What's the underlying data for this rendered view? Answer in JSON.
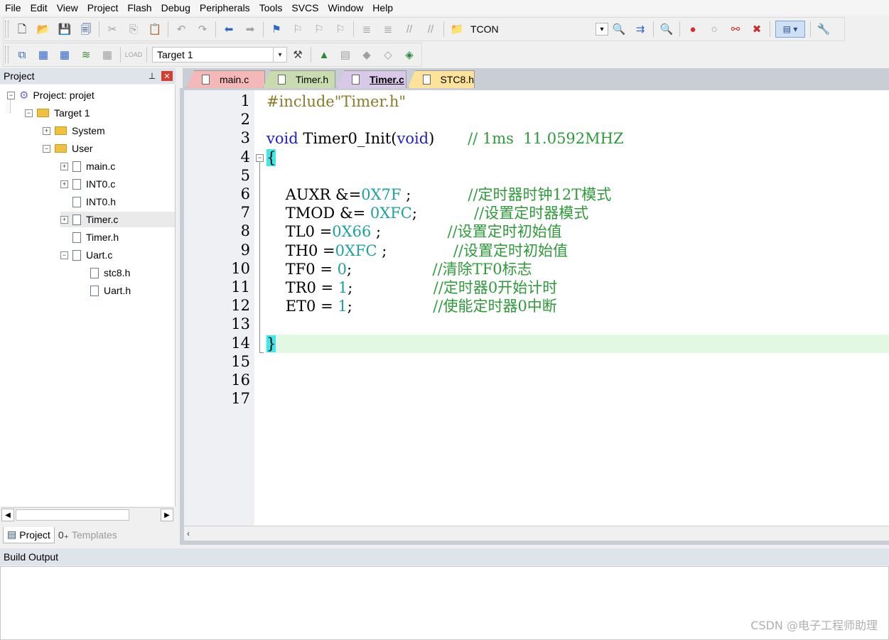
{
  "menu": [
    "File",
    "Edit",
    "View",
    "Project",
    "Flash",
    "Debug",
    "Peripherals",
    "Tools",
    "SVCS",
    "Window",
    "Help"
  ],
  "toolbar1": {
    "search_value": "TCON"
  },
  "toolbar2": {
    "target_value": "Target 1"
  },
  "project_panel": {
    "title": "Project",
    "tree": [
      {
        "label": "Project: projet",
        "level": 0,
        "expander": "minus",
        "icon": "project"
      },
      {
        "label": "Target 1",
        "level": 1,
        "expander": "minus",
        "icon": "folder"
      },
      {
        "label": "System",
        "level": 2,
        "expander": "plus",
        "icon": "folder"
      },
      {
        "label": "User",
        "level": 2,
        "expander": "minus",
        "icon": "folder"
      },
      {
        "label": "main.c",
        "level": 3,
        "expander": "plus",
        "icon": "file"
      },
      {
        "label": "INT0.c",
        "level": 3,
        "expander": "plus",
        "icon": "file"
      },
      {
        "label": "INT0.h",
        "level": 3,
        "expander": "none",
        "icon": "file"
      },
      {
        "label": "Timer.c",
        "level": 3,
        "expander": "plus",
        "icon": "file",
        "highlighted": true
      },
      {
        "label": "Timer.h",
        "level": 3,
        "expander": "none",
        "icon": "file"
      },
      {
        "label": "Uart.c",
        "level": 3,
        "expander": "minus",
        "icon": "file"
      },
      {
        "label": "stc8.h",
        "level": 4,
        "expander": "none",
        "icon": "file"
      },
      {
        "label": "Uart.h",
        "level": 4,
        "expander": "none",
        "icon": "file"
      }
    ],
    "tabs": [
      {
        "label": "Project",
        "active": true
      },
      {
        "label": "Templates",
        "active": false
      }
    ]
  },
  "editor": {
    "tabs": [
      {
        "label": "main.c",
        "color": "#f4b8b8",
        "active": false
      },
      {
        "label": "Timer.h",
        "color": "#c9dcb0",
        "active": false
      },
      {
        "label": "Timer.c",
        "color": "#d9c9e9",
        "active": true
      },
      {
        "label": "STC8.h",
        "color": "#fde39a",
        "active": false
      }
    ],
    "line_numbers": [
      "1",
      "2",
      "3",
      "4",
      "5",
      "6",
      "7",
      "8",
      "9",
      "10",
      "11",
      "12",
      "13",
      "14",
      "15",
      "16",
      "17"
    ],
    "lines": [
      [
        {
          "t": "#include",
          "c": "pp"
        },
        {
          "t": "\"Timer.h\"",
          "c": "str"
        }
      ],
      [],
      [
        {
          "t": "void",
          "c": "kw"
        },
        {
          "t": " Timer0_Init(",
          "c": "tx"
        },
        {
          "t": "void",
          "c": "kw"
        },
        {
          "t": ")       ",
          "c": "tx"
        },
        {
          "t": "// 1ms  11.0592MHZ",
          "c": "cm"
        }
      ],
      [
        {
          "t": "{",
          "c": "tx"
        }
      ],
      [],
      [
        {
          "t": "    AUXR &=",
          "c": "tx"
        },
        {
          "t": "0X7F",
          "c": "num"
        },
        {
          "t": " ;            ",
          "c": "tx"
        },
        {
          "t": "//定时器时钟12T模式",
          "c": "cm"
        }
      ],
      [
        {
          "t": "    TMOD &= ",
          "c": "tx"
        },
        {
          "t": "0XFC",
          "c": "num"
        },
        {
          "t": ";            ",
          "c": "tx"
        },
        {
          "t": "//设置定时器模式",
          "c": "cm"
        }
      ],
      [
        {
          "t": "    TL0 =",
          "c": "tx"
        },
        {
          "t": "0X66",
          "c": "num"
        },
        {
          "t": " ;              ",
          "c": "tx"
        },
        {
          "t": "//设置定时初始值",
          "c": "cm"
        }
      ],
      [
        {
          "t": "    TH0 =",
          "c": "tx"
        },
        {
          "t": "0XFC",
          "c": "num"
        },
        {
          "t": " ;              ",
          "c": "tx"
        },
        {
          "t": "//设置定时初始值",
          "c": "cm"
        }
      ],
      [
        {
          "t": "    TF0 = ",
          "c": "tx"
        },
        {
          "t": "0",
          "c": "num"
        },
        {
          "t": ";                 ",
          "c": "tx"
        },
        {
          "t": "//清除TF0标志",
          "c": "cm"
        }
      ],
      [
        {
          "t": "    TR0 = ",
          "c": "tx"
        },
        {
          "t": "1",
          "c": "num"
        },
        {
          "t": ";                 ",
          "c": "tx"
        },
        {
          "t": "//定时器0开始计时",
          "c": "cm"
        }
      ],
      [
        {
          "t": "    ET0 = ",
          "c": "tx"
        },
        {
          "t": "1",
          "c": "num"
        },
        {
          "t": ";                 ",
          "c": "tx"
        },
        {
          "t": "//使能定时器0中断",
          "c": "cm"
        }
      ],
      [],
      [
        {
          "t": "}",
          "c": "tx"
        }
      ],
      [],
      [],
      []
    ],
    "current_line": 14
  },
  "build_output": {
    "title": "Build Output"
  },
  "watermark": "CSDN @电子工程师助理"
}
